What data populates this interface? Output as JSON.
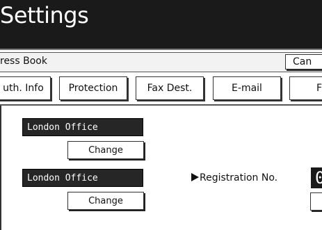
{
  "title": "Settings",
  "subheader": {
    "label": "ress Book",
    "cancel_label": "Can"
  },
  "tabs": [
    {
      "label": "uth. Info"
    },
    {
      "label": "Protection"
    },
    {
      "label": "Fax Dest."
    },
    {
      "label": "E-mail"
    },
    {
      "label": "Fol"
    }
  ],
  "content": {
    "field1": {
      "value": "London Office",
      "button_label": "Change"
    },
    "field2": {
      "value": "London Office",
      "button_label": "Change"
    },
    "registration": {
      "label": "Registration No.",
      "value": "0"
    }
  },
  "colors": {
    "title_bar": "#1a1a1a",
    "field_bg": "#262626",
    "field_text": "#ffffff"
  }
}
